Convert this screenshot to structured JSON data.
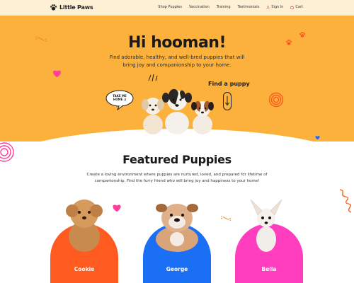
{
  "brand": {
    "name": "Little Paws",
    "logo_icon": "paw-icon"
  },
  "nav": {
    "items": [
      {
        "label": "Shop Puppies"
      },
      {
        "label": "Vaccination"
      },
      {
        "label": "Training"
      },
      {
        "label": "Testimonials"
      },
      {
        "label": "Sign In",
        "icon": "user-icon"
      },
      {
        "label": "Cart",
        "icon": "cart-icon"
      }
    ]
  },
  "hero": {
    "title": "Hi hooman!",
    "subtitle": "Find adorable, healthy, and well-bred puppies that will bring joy and companionship to your home.",
    "cta": "Find a puppy",
    "bubble": "TAKE ME HOME :)"
  },
  "featured": {
    "title": "Featured Puppies",
    "text": "Create a loving environment where puppies are nurtured, loved, and prepared for lifetime of companionship. Find the furry friend who will bring joy and happiness to your home!",
    "cards": [
      {
        "name": "Cookie",
        "color": "#ff5a1f"
      },
      {
        "name": "George",
        "color": "#1a6ff5"
      },
      {
        "name": "Bella",
        "color": "#ff3dbf"
      }
    ]
  },
  "colors": {
    "hero_bg": "#fbb13c",
    "nav_bg": "#fdf0d4"
  }
}
